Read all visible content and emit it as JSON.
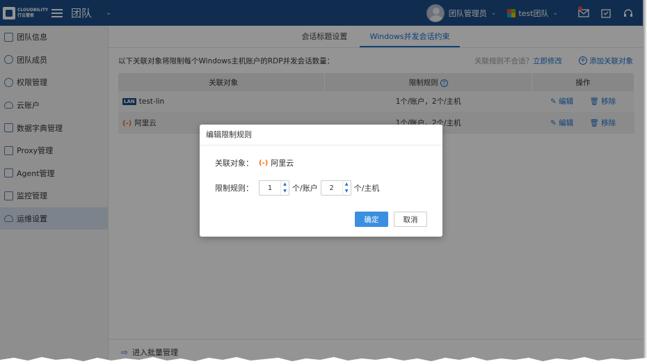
{
  "topbar": {
    "logo_text_line1": "CLOUDBILITY",
    "logo_text_line2": "行云管家",
    "team_title": "团队",
    "user_name": "团队管理员",
    "team_name": "test团队",
    "colors": {
      "bg": "#1c4f8a"
    }
  },
  "sidebar": {
    "items": [
      {
        "label": "团队信息",
        "icon": "document-icon"
      },
      {
        "label": "团队成员",
        "icon": "members-icon"
      },
      {
        "label": "权限管理",
        "icon": "key-user-icon"
      },
      {
        "label": "云账户",
        "icon": "cloud-icon"
      },
      {
        "label": "数据字典管理",
        "icon": "book-icon"
      },
      {
        "label": "Proxy管理",
        "icon": "proxy-icon"
      },
      {
        "label": "Agent管理",
        "icon": "agent-icon"
      },
      {
        "label": "监控管理",
        "icon": "monitor-icon"
      },
      {
        "label": "运维设置",
        "icon": "settings-icon",
        "active": true
      }
    ]
  },
  "tabs": [
    {
      "label": "会话标题设置"
    },
    {
      "label": "Windows并发会话约束",
      "active": true
    }
  ],
  "description": "以下关联对象将限制每个Windows主机账户的RDP并发会话数量：",
  "rule_hint": "关联规则不合适？",
  "rule_hint_link": "立即修改",
  "add_link": "添加关联对象",
  "table": {
    "headers": [
      "关联对象",
      "限制规则",
      "操作"
    ],
    "rows": [
      {
        "badge": "LAN",
        "name": "test-lin",
        "rule": "1个/账户，2个/主机",
        "edit": "编辑",
        "remove": "移除"
      },
      {
        "badge": "(-)",
        "name": "阿里云",
        "rule": "1个/账户，2个/主机",
        "edit": "编辑",
        "remove": "移除"
      }
    ]
  },
  "footer": {
    "label": "进入批量管理"
  },
  "modal": {
    "title": "编辑限制规则",
    "object_label": "关联对象：",
    "object_icon": "(-)",
    "object_name": "阿里云",
    "rule_label": "限制规则：",
    "account_value": "1",
    "account_unit": "个/账户",
    "host_value": "2",
    "host_unit": "个/主机",
    "confirm": "确定",
    "cancel": "取消"
  }
}
